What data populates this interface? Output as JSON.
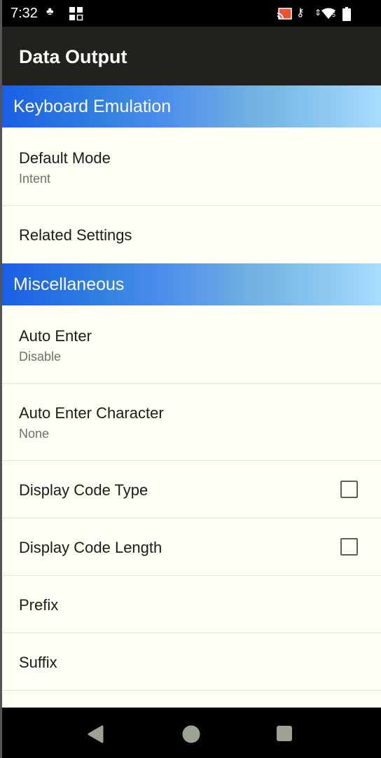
{
  "status_bar": {
    "time": "7:32",
    "icons": [
      "alien-icon",
      "grid-apps-icon",
      "cast-icon",
      "vpn-key-icon",
      "data-arrows-icon",
      "wifi-icon",
      "battery-icon"
    ],
    "wifi_badge": "5"
  },
  "app_bar": {
    "title": "Data Output"
  },
  "sections": [
    {
      "title": "Keyboard Emulation",
      "items": [
        {
          "title": "Default Mode",
          "summary": "Intent"
        },
        {
          "title": "Related Settings"
        }
      ]
    },
    {
      "title": "Miscellaneous",
      "items": [
        {
          "title": "Auto Enter",
          "summary": "Disable"
        },
        {
          "title": "Auto Enter Character",
          "summary": "None"
        },
        {
          "title": "Display Code Type",
          "checked": false
        },
        {
          "title": "Display Code Length",
          "checked": false
        },
        {
          "title": "Prefix"
        },
        {
          "title": "Suffix"
        }
      ]
    }
  ],
  "nav_bar": {
    "buttons": [
      "back",
      "home",
      "recents"
    ]
  }
}
